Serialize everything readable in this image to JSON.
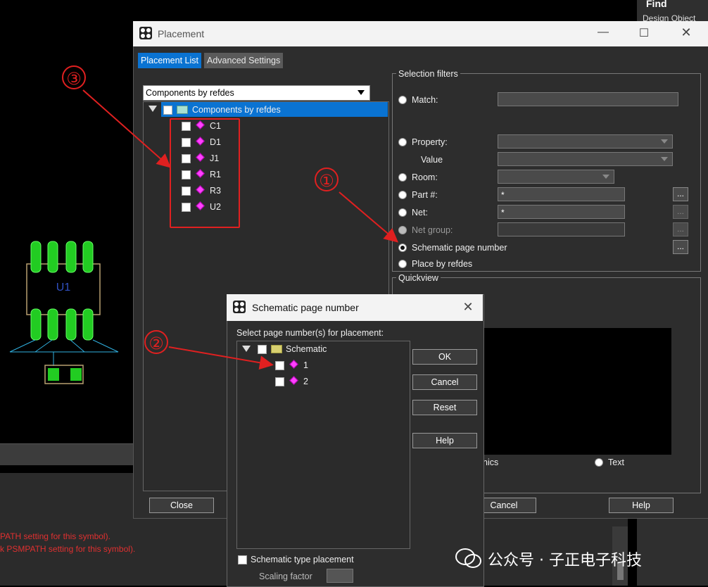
{
  "background": {
    "find_panel": {
      "title": "Find",
      "subtitle": "Design Object"
    },
    "console_lines": [
      "PATH setting for this symbol).",
      "k PSMPATH setting for this symbol)."
    ],
    "footprint_label": "U1"
  },
  "placement": {
    "title": "Placement",
    "tabs": [
      {
        "label": "Placement List",
        "active": true
      },
      {
        "label": "Advanced Settings",
        "active": false
      }
    ],
    "list_combo_value": "Components by refdes",
    "tree_root": "Components by refdes",
    "components": [
      "C1",
      "D1",
      "J1",
      "R1",
      "R3",
      "U2"
    ],
    "selection_filters": {
      "group_label": "Selection filters",
      "match_label": "Match:",
      "property_label": "Property:",
      "value_label": "Value",
      "room_label": "Room:",
      "part_label": "Part #:",
      "part_value": "*",
      "net_label": "Net:",
      "net_value": "*",
      "net_group_label": "Net group:",
      "schematic_page_label": "Schematic page number",
      "place_by_refdes_label": "Place by refdes",
      "dots_label": "..."
    },
    "quickview": {
      "group_label": "Quickview",
      "graphics_partial": "nics",
      "text_label": "Text"
    },
    "buttons": {
      "close": "Close",
      "cancel": "Cancel",
      "help": "Help"
    }
  },
  "schematic_dialog": {
    "title": "Schematic page number",
    "prompt": "Select page number(s) for placement:",
    "tree_root": "Schematic",
    "pages": [
      "1",
      "2"
    ],
    "buttons": {
      "ok": "OK",
      "cancel": "Cancel",
      "reset": "Reset",
      "help": "Help"
    },
    "type_placement_label": "Schematic type placement",
    "scaling_factor_label": "Scaling factor"
  },
  "annotations": {
    "one": "①",
    "two": "②",
    "three": "③"
  },
  "watermark": "公众号 · 子正电子科技",
  "colors": {
    "accent": "#0a73d2",
    "annotation": "#e02020",
    "footprint": "#22cc22"
  }
}
